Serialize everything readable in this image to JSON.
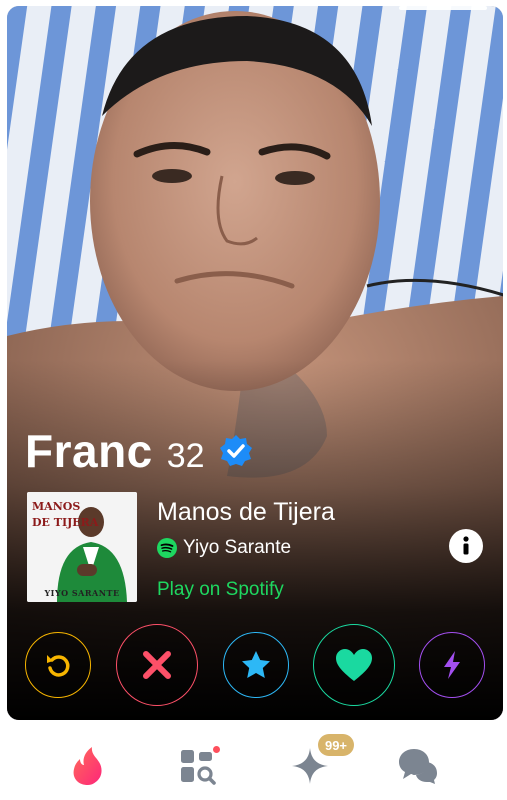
{
  "profile": {
    "name": "Franc",
    "age": "32",
    "verified": true
  },
  "anthem": {
    "album_art_line1": "MANOS",
    "album_art_line2": "DE TIJERA",
    "album_art_artist": "YIYO SARANTE",
    "title": "Manos de Tijera",
    "artist": "Yiyo Sarante",
    "play_label": "Play on Spotify",
    "service_icon": "spotify-icon"
  },
  "actions": [
    {
      "name": "rewind",
      "icon": "rewind-icon",
      "color": "#f7b500"
    },
    {
      "name": "nope",
      "icon": "x-icon",
      "color": "#fd5068"
    },
    {
      "name": "super-like",
      "icon": "star-icon",
      "color": "#2db8f6"
    },
    {
      "name": "like",
      "icon": "heart-icon",
      "color": "#1ad9a0"
    },
    {
      "name": "boost",
      "icon": "bolt-icon",
      "color": "#a34ff0"
    }
  ],
  "tabbar": {
    "tabs": [
      {
        "name": "discover",
        "icon": "flame-icon",
        "active": true
      },
      {
        "name": "explore",
        "icon": "explore-grid-icon",
        "has_dot": true
      },
      {
        "name": "likes",
        "icon": "sparkle-icon",
        "badge": "99+"
      },
      {
        "name": "chat",
        "icon": "chat-bubbles-icon"
      }
    ],
    "likes_badge": "99+"
  },
  "colors": {
    "accent": "#fe3c72",
    "spotify_green": "#1ed760",
    "verified_blue": "#1d8cf8",
    "badge_gold": "#d8b46a"
  }
}
